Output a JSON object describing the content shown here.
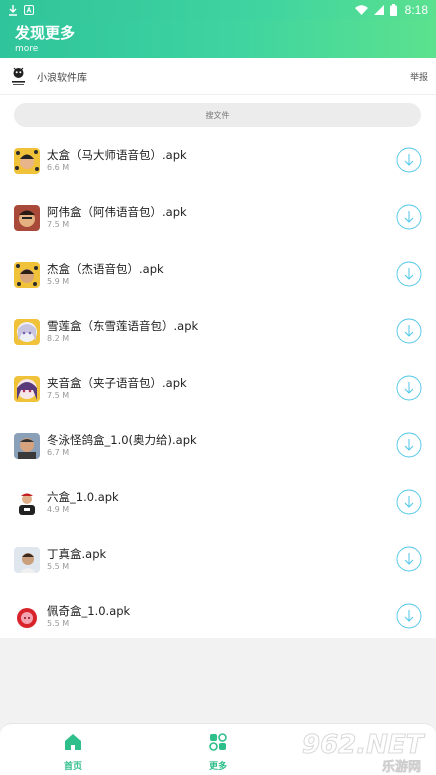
{
  "statusbar": {
    "time": "8:18"
  },
  "header": {
    "title": "发现更多",
    "subtitle": "more"
  },
  "source": {
    "name": "小浪软件库",
    "report": "举报"
  },
  "search": {
    "placeholder": "搜文件"
  },
  "items": [
    {
      "name": "太盒（马大师语音包）.apk",
      "size": "6.6 M"
    },
    {
      "name": "阿伟盒（阿伟语音包）.apk",
      "size": "7.5 M"
    },
    {
      "name": "杰盒（杰语音包）.apk",
      "size": "5.9 M"
    },
    {
      "name": "雪莲盒（东雪莲语音包）.apk",
      "size": "8.2 M"
    },
    {
      "name": "夹音盒（夹子语音包）.apk",
      "size": "7.5 M"
    },
    {
      "name": "冬泳怪鸽盒_1.0(奥力给).apk",
      "size": "6.7 M"
    },
    {
      "name": "六盒_1.0.apk",
      "size": "4.9 M"
    },
    {
      "name": "丁真盒.apk",
      "size": "5.5 M"
    },
    {
      "name": "佩奇盒_1.0.apk",
      "size": "5.5 M"
    }
  ],
  "nav": {
    "home": "首页",
    "more": "更多"
  },
  "watermark": {
    "brand": "962.NET",
    "site": "乐游网"
  },
  "colors": {
    "accent": "#3fd4a0",
    "download": "#4fc6e8"
  }
}
